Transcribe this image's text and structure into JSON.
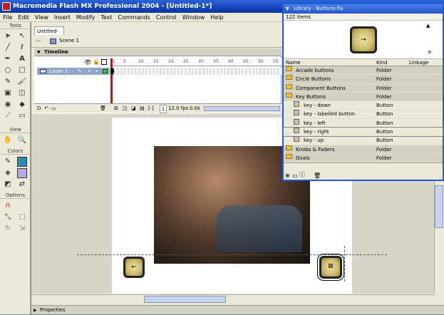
{
  "window": {
    "title": "Macromedia Flash MX Professional 2004 - [Untitled-1*]"
  },
  "menu": [
    "File",
    "Edit",
    "View",
    "Insert",
    "Modify",
    "Text",
    "Commands",
    "Control",
    "Window",
    "Help"
  ],
  "tools": {
    "header": "Tools",
    "view_header": "View",
    "colors_header": "Colors",
    "options_header": "Options"
  },
  "document": {
    "tab": "Untitled-1*",
    "scene": "Scene 1",
    "timeline_label": "Timeline",
    "layer_name": "Layer 1",
    "frame_numbers": [
      "1",
      "5",
      "10",
      "15",
      "20",
      "25",
      "30",
      "35",
      "40",
      "45",
      "50",
      "55"
    ],
    "frame": "1",
    "fps": "12.0 fps",
    "time": "0.0s"
  },
  "properties_label": "Properties",
  "library": {
    "title": "Library - Buttons.fla",
    "count": "122 items",
    "columns": [
      "Name",
      "Kind",
      "Linkage"
    ],
    "items": [
      {
        "name": "Arcade buttons",
        "kind": "Folder",
        "type": "folder",
        "indent": 0
      },
      {
        "name": "Circle Buttons",
        "kind": "Folder",
        "type": "folder",
        "indent": 0
      },
      {
        "name": "Component Buttons",
        "kind": "Folder",
        "type": "folder",
        "indent": 0
      },
      {
        "name": "Key Buttons",
        "kind": "Folder",
        "type": "folder-open",
        "indent": 0
      },
      {
        "name": "key - down",
        "kind": "Button",
        "type": "button",
        "indent": 1
      },
      {
        "name": "key - labelled button",
        "kind": "Button",
        "type": "button",
        "indent": 1
      },
      {
        "name": "key - left",
        "kind": "Button",
        "type": "button",
        "indent": 1
      },
      {
        "name": "key - right",
        "kind": "Button",
        "type": "button",
        "indent": 1,
        "selected": true
      },
      {
        "name": "key - up",
        "kind": "Button",
        "type": "button",
        "indent": 1
      },
      {
        "name": "Knobs & Faders",
        "kind": "Folder",
        "type": "folder",
        "indent": 0
      },
      {
        "name": "Ovals",
        "kind": "Folder",
        "type": "folder",
        "indent": 0
      }
    ]
  },
  "colors": {
    "accent": "#1c5be0",
    "playhead": "#e00000",
    "key_face": "#e8dc98"
  }
}
